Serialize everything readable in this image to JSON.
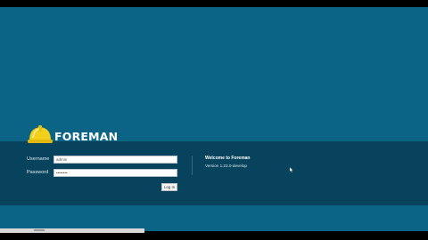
{
  "app": {
    "logo_text": "FOREMAN"
  },
  "login": {
    "username_label": "Username",
    "username_value": "admin",
    "password_label": "Password",
    "password_value": "••••••••",
    "login_button": "Log In"
  },
  "welcome": {
    "title": "Welcome to Foreman",
    "version": "Version 1.23.0-develop"
  },
  "colors": {
    "background": "#0b6386",
    "band": "#07435c",
    "helmet": "#f3d01c"
  }
}
